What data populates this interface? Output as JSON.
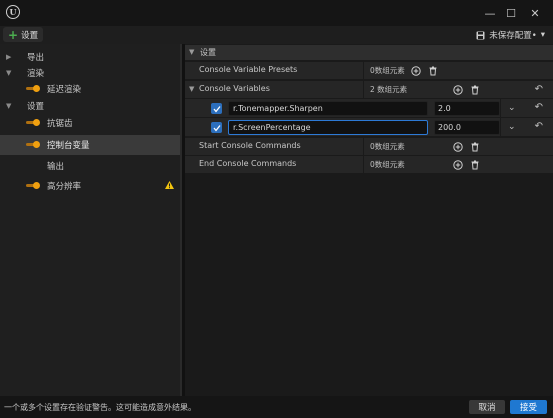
{
  "window": {
    "logo_letter": "U",
    "minimize_symbol": "—",
    "maximize_symbol": "☐",
    "close_symbol": "✕"
  },
  "toolbar": {
    "settings_label": "设置",
    "unsaved_label": "未保存配置•",
    "dropdown_symbol": "▾"
  },
  "sidebar": {
    "items": [
      {
        "label": "导出",
        "type": "category"
      },
      {
        "label": "渲染",
        "type": "category"
      },
      {
        "label": "延迟渲染",
        "type": "setting"
      },
      {
        "label": "设置",
        "type": "category"
      },
      {
        "label": "抗锯齿",
        "type": "setting"
      },
      {
        "label": "控制台变量",
        "type": "setting",
        "selected": true
      },
      {
        "label": "输出",
        "type": "setting"
      },
      {
        "label": "高分辨率",
        "type": "setting",
        "warning": true
      }
    ]
  },
  "details": {
    "section_title": "设置",
    "rows": [
      {
        "name": "Console Variable Presets",
        "count": "0数组元素"
      },
      {
        "name": "Console Variables",
        "count": "2 数组元素"
      },
      {
        "name": "Start Console Commands",
        "count": "0数组元素"
      },
      {
        "name": "End Console Commands",
        "count": "0数组元素"
      }
    ],
    "cvars": [
      {
        "name": "r.Tonemapper.Sharpen",
        "value": "2.0",
        "enabled": true
      },
      {
        "name": "r.ScreenPercentage",
        "value": "200.0",
        "enabled": true
      }
    ]
  },
  "status": {
    "message": "一个或多个设置存在验证警告。这可能造成意外结果。",
    "cancel_label": "取消",
    "accept_label": "接受"
  },
  "colors": {
    "accent": "#1f78d1",
    "toggle": "#f0a010",
    "warning": "#f2c40f",
    "add": "#4caf50"
  }
}
